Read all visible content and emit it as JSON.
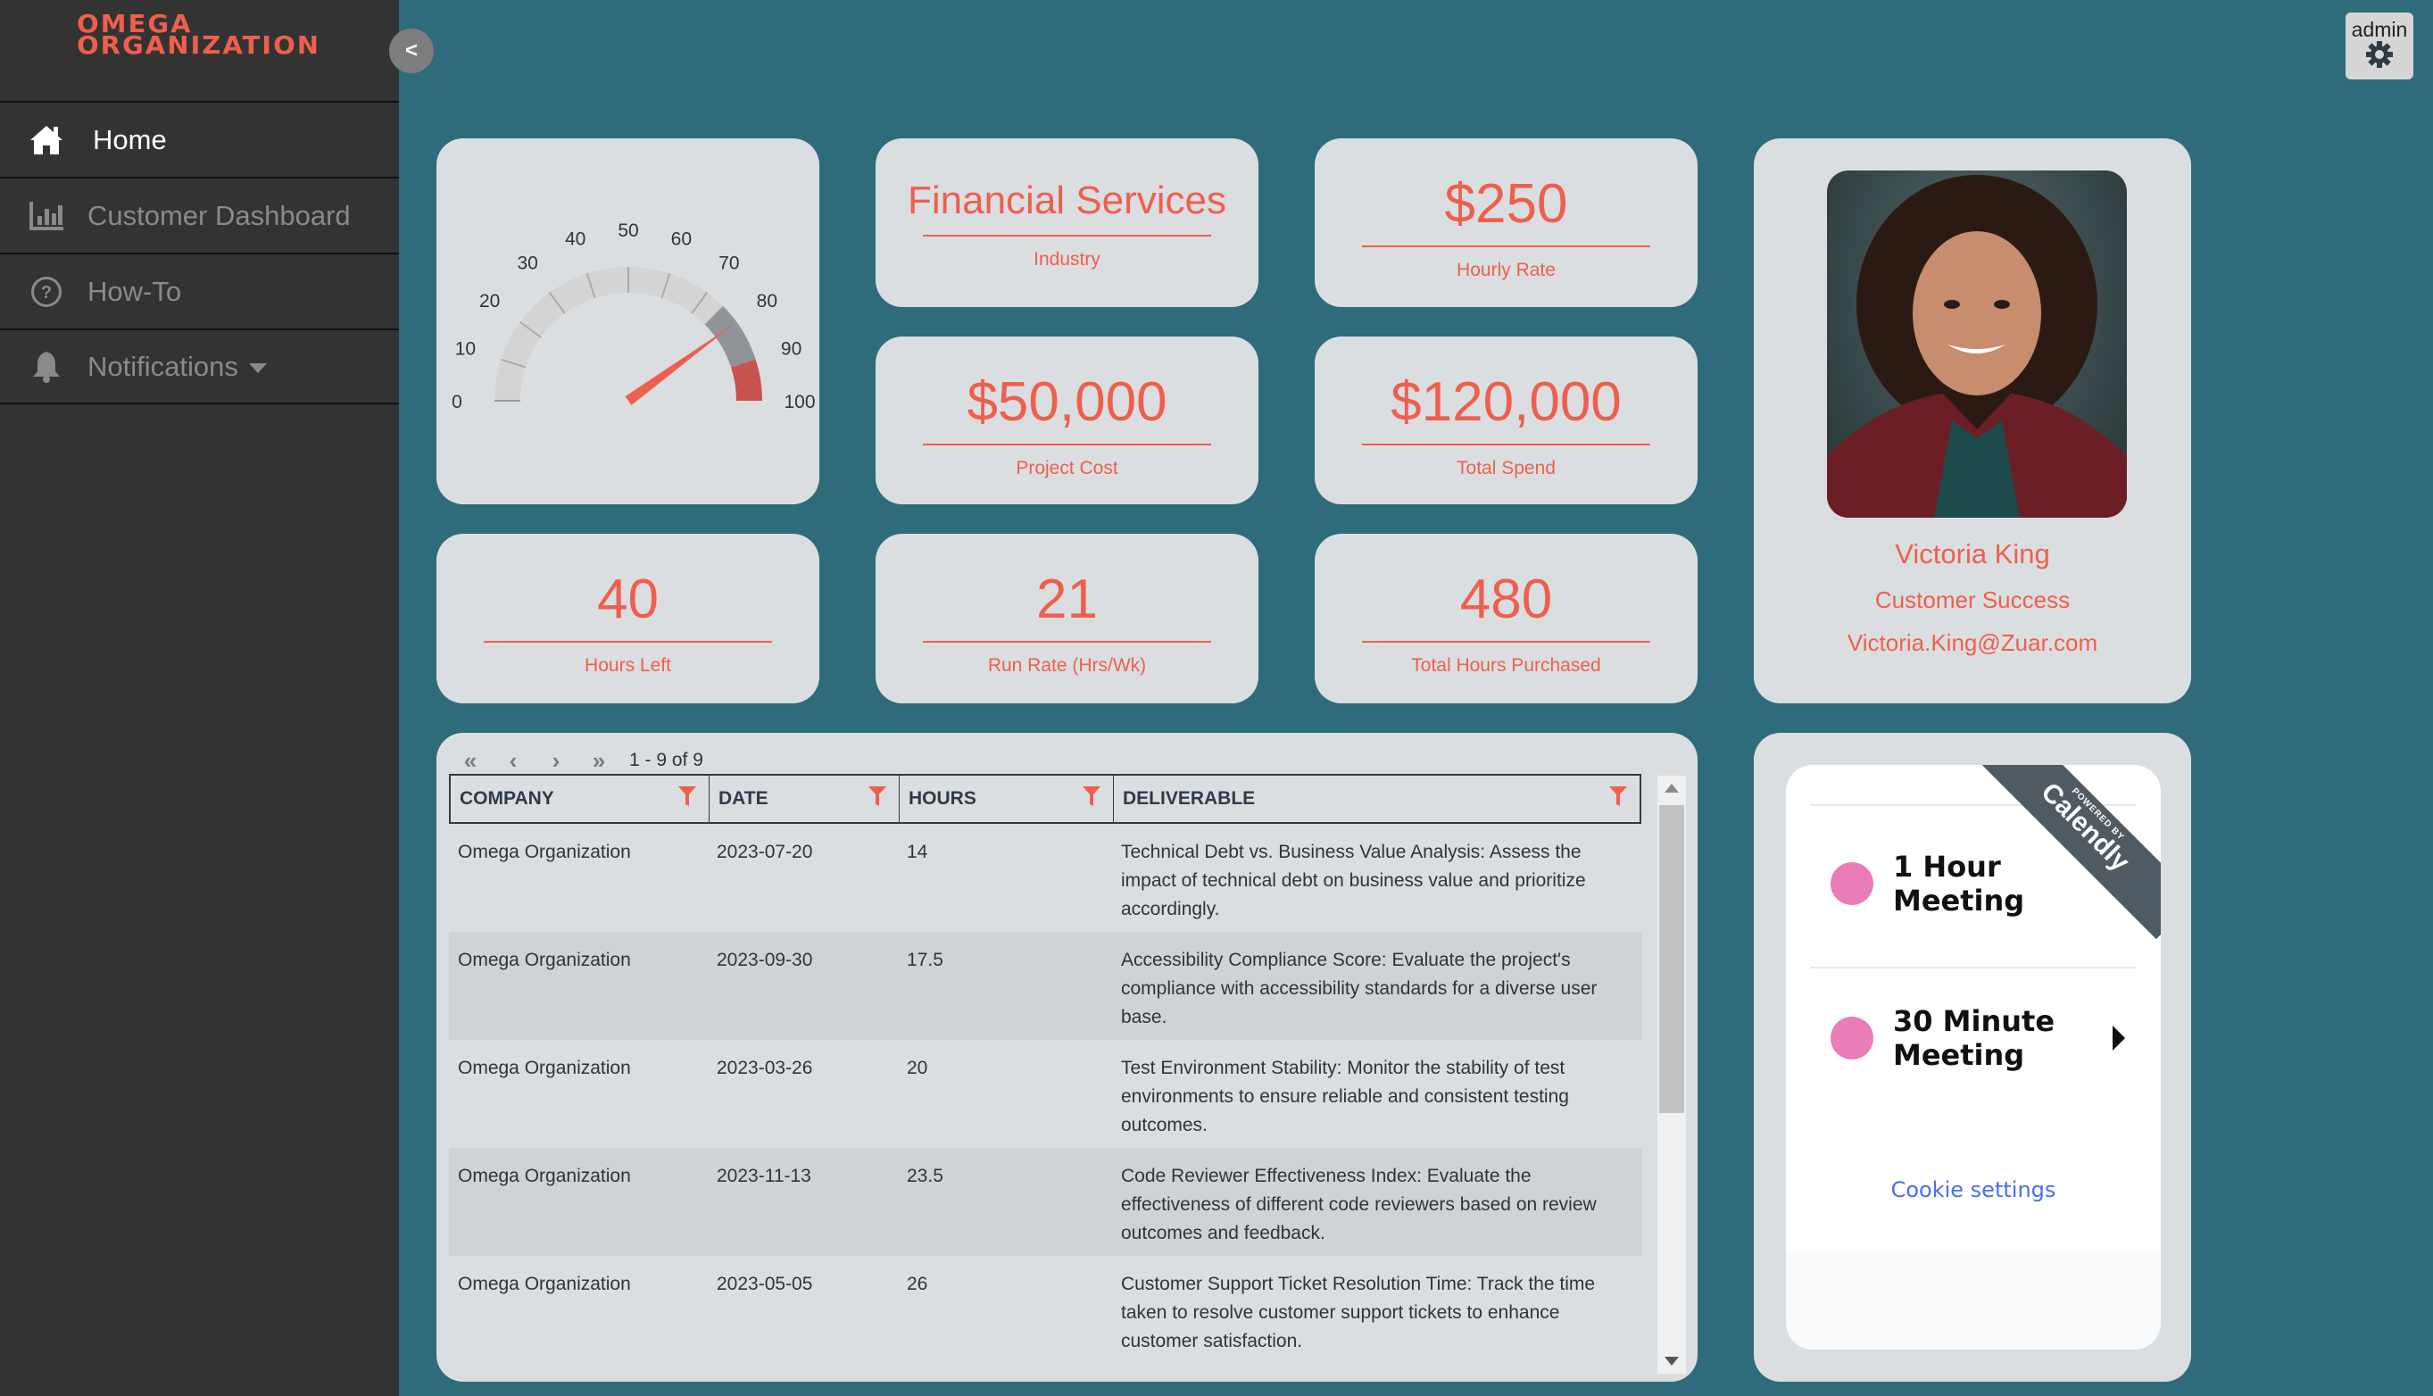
{
  "brand": {
    "logo_line1": "OMEGA",
    "logo_line2": "ORGANIZATION",
    "accent_color": "#ee5f4d",
    "background_color": "#2e6c7b"
  },
  "sidebar": {
    "collapse_label": "<",
    "items": [
      {
        "label": "Home",
        "icon": "home-icon",
        "active": true
      },
      {
        "label": "Customer Dashboard",
        "icon": "bar-chart-icon",
        "active": false
      },
      {
        "label": "How-To",
        "icon": "question-circle-icon",
        "active": false
      },
      {
        "label": "Notifications",
        "icon": "bell-icon",
        "active": false,
        "has_dropdown": true
      }
    ]
  },
  "header": {
    "admin_label": "admin",
    "settings_icon": "gear-icon"
  },
  "gauge": {
    "value": 80,
    "min": 0,
    "max": 100,
    "ticks": [
      "0",
      "10",
      "20",
      "30",
      "40",
      "50",
      "60",
      "70",
      "80",
      "90",
      "100"
    ],
    "bands": [
      {
        "from": 0,
        "to": 75,
        "color": "#d4d4d4"
      },
      {
        "from": 75,
        "to": 90,
        "color": "#909398"
      },
      {
        "from": 90,
        "to": 100,
        "color": "#c85450"
      }
    ],
    "needle_color": "#ee5f4d"
  },
  "kpis": {
    "industry": {
      "value": "Financial Services",
      "caption": "Industry"
    },
    "hourly_rate": {
      "value": "$250",
      "caption": "Hourly Rate"
    },
    "project_cost": {
      "value": "$50,000",
      "caption": "Project Cost"
    },
    "total_spend": {
      "value": "$120,000",
      "caption": "Total Spend"
    },
    "hours_left": {
      "value": "40",
      "caption": "Hours Left"
    },
    "run_rate": {
      "value": "21",
      "caption": "Run Rate (Hrs/Wk)"
    },
    "total_hours": {
      "value": "480",
      "caption": "Total Hours Purchased"
    }
  },
  "profile": {
    "name": "Victoria King",
    "role": "Customer Success",
    "email": "Victoria.King@Zuar.com"
  },
  "table": {
    "pager": {
      "first": "«",
      "prev": "‹",
      "next": "›",
      "last": "»",
      "range": "1 - 9 of 9"
    },
    "columns": [
      "COMPANY",
      "DATE",
      "HOURS",
      "DELIVERABLE"
    ],
    "rows": [
      {
        "company": "Omega Organization",
        "date": "2023-07-20",
        "hours": "14",
        "deliverable": "Technical Debt vs. Business Value Analysis: Assess the impact of technical debt on business value and prioritize accordingly."
      },
      {
        "company": "Omega Organization",
        "date": "2023-09-30",
        "hours": "17.5",
        "deliverable": "Accessibility Compliance Score: Evaluate the project's compliance with accessibility standards for a diverse user base."
      },
      {
        "company": "Omega Organization",
        "date": "2023-03-26",
        "hours": "20",
        "deliverable": "Test Environment Stability: Monitor the stability of test environments to ensure reliable and consistent testing outcomes."
      },
      {
        "company": "Omega Organization",
        "date": "2023-11-13",
        "hours": "23.5",
        "deliverable": "Code Reviewer Effectiveness Index: Evaluate the effectiveness of different code reviewers based on review outcomes and feedback."
      },
      {
        "company": "Omega Organization",
        "date": "2023-05-05",
        "hours": "26",
        "deliverable": "Customer Support Ticket Resolution Time: Track the time taken to resolve customer support tickets to enhance customer satisfaction."
      }
    ]
  },
  "calendly": {
    "ribbon_small": "POWERED BY",
    "ribbon_big": "Calendly",
    "events": [
      {
        "label": "1 Hour Meeting",
        "color": "#e97db7"
      },
      {
        "label": "30 Minute Meeting",
        "color": "#e97db7"
      }
    ],
    "cookie_label": "Cookie settings"
  }
}
